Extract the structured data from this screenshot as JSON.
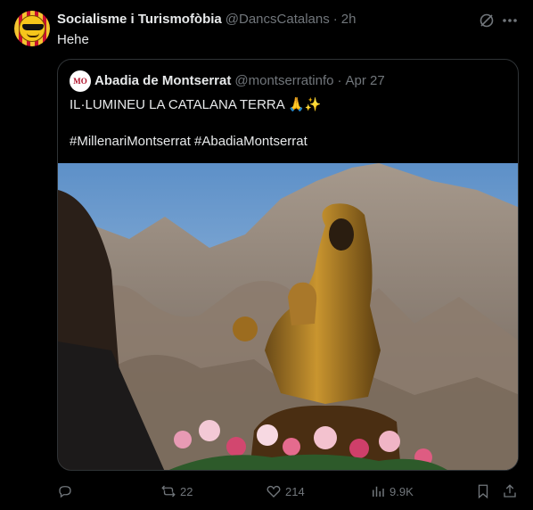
{
  "post": {
    "author_name": "Socialisme i Turismofòbia",
    "author_handle": "@DancsCatalans",
    "separator": "·",
    "time": "2h",
    "text": "Hehe"
  },
  "quote": {
    "author_name": "Abadia de Montserrat",
    "author_handle": "@montserratinfo",
    "separator": "·",
    "date": "Apr 27",
    "avatar_text": "MO",
    "text": "IL·LUMINEU LA CATALANA TERRA 🙏✨",
    "hashtags": "#MillenariMontserrat #AbadiaMontserrat"
  },
  "actions": {
    "reply_count": "",
    "retweet_count": "22",
    "like_count": "214",
    "views_count": "9.9K"
  },
  "icons": {
    "header": [
      "grok-icon",
      "more-icon"
    ],
    "actions": [
      "reply-icon",
      "retweet-icon",
      "like-icon",
      "views-icon",
      "bookmark-icon",
      "share-icon"
    ]
  },
  "colors": {
    "background": "#000000",
    "text_primary": "#e7e9ea",
    "text_secondary": "#71767b",
    "border": "#2f3336"
  }
}
